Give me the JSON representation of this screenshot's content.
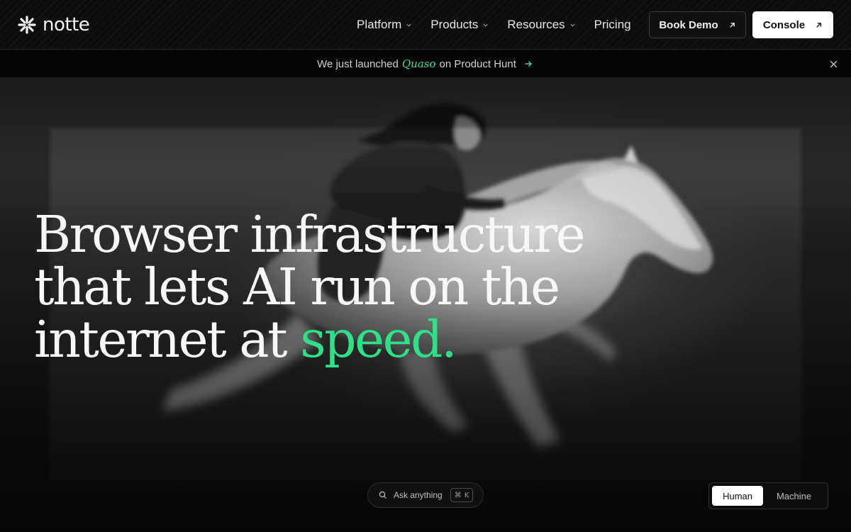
{
  "header": {
    "logo_text": "notte",
    "nav": [
      {
        "label": "Platform",
        "has_dropdown": true
      },
      {
        "label": "Products",
        "has_dropdown": true
      },
      {
        "label": "Resources",
        "has_dropdown": true
      },
      {
        "label": "Pricing",
        "has_dropdown": false
      }
    ],
    "book_demo_label": "Book Demo",
    "console_label": "Console"
  },
  "announcement": {
    "prefix": "We just launched",
    "product": "Quaso",
    "suffix": "on Product Hunt"
  },
  "hero": {
    "title_line1": "Browser infrastructure",
    "title_line2": "that lets AI run on the",
    "title_line3_prefix": "internet at",
    "title_accent": "speed."
  },
  "ask": {
    "label": "Ask anything",
    "shortcut_symbol": "⌘",
    "shortcut_key": "K"
  },
  "mode_toggle": {
    "options": [
      "Human",
      "Machine"
    ],
    "active": "Human"
  },
  "colors": {
    "accent": "#2fe08b",
    "background": "#0b0b0b",
    "text": "#f7f7f7"
  }
}
